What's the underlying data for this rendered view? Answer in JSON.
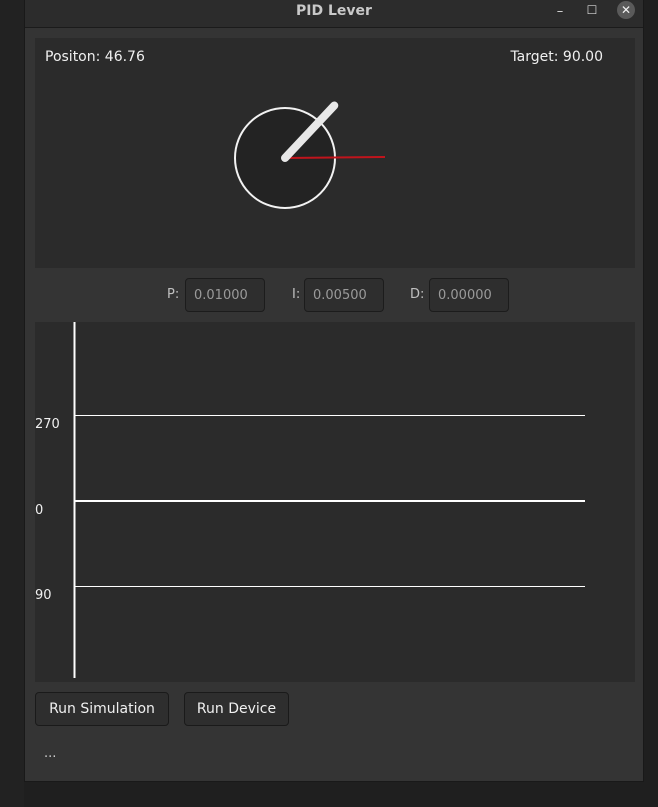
{
  "window": {
    "title": "PID Lever",
    "minimize_glyph": "–",
    "maximize_glyph": "☐",
    "close_glyph": "✕"
  },
  "dial": {
    "position_label": "Positon: 46.76",
    "target_label": "Target: 90.00",
    "position_deg": 46.76,
    "target_deg": 90.0,
    "lever_color": "#e8e8e8",
    "target_line_color": "#c0141c"
  },
  "pid": {
    "p_label": "P:",
    "p_value": "0.01000",
    "i_label": "I:",
    "i_value": "0.00500",
    "d_label": "D:",
    "d_value": "0.00000"
  },
  "graph": {
    "tick_top": "270",
    "tick_mid": "0",
    "tick_bottom": "90"
  },
  "buttons": {
    "run_simulation": "Run Simulation",
    "run_device": "Run Device"
  },
  "status": {
    "text": "..."
  }
}
